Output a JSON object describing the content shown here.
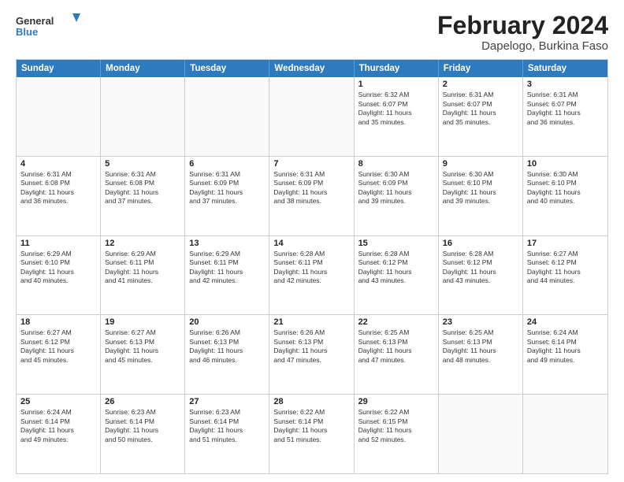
{
  "header": {
    "logo_general": "General",
    "logo_blue": "Blue",
    "title": "February 2024",
    "subtitle": "Dapelogo, Burkina Faso"
  },
  "weekdays": [
    "Sunday",
    "Monday",
    "Tuesday",
    "Wednesday",
    "Thursday",
    "Friday",
    "Saturday"
  ],
  "rows": [
    [
      {
        "day": "",
        "info": ""
      },
      {
        "day": "",
        "info": ""
      },
      {
        "day": "",
        "info": ""
      },
      {
        "day": "",
        "info": ""
      },
      {
        "day": "1",
        "info": "Sunrise: 6:32 AM\nSunset: 6:07 PM\nDaylight: 11 hours\nand 35 minutes."
      },
      {
        "day": "2",
        "info": "Sunrise: 6:31 AM\nSunset: 6:07 PM\nDaylight: 11 hours\nand 35 minutes."
      },
      {
        "day": "3",
        "info": "Sunrise: 6:31 AM\nSunset: 6:07 PM\nDaylight: 11 hours\nand 36 minutes."
      }
    ],
    [
      {
        "day": "4",
        "info": "Sunrise: 6:31 AM\nSunset: 6:08 PM\nDaylight: 11 hours\nand 36 minutes."
      },
      {
        "day": "5",
        "info": "Sunrise: 6:31 AM\nSunset: 6:08 PM\nDaylight: 11 hours\nand 37 minutes."
      },
      {
        "day": "6",
        "info": "Sunrise: 6:31 AM\nSunset: 6:09 PM\nDaylight: 11 hours\nand 37 minutes."
      },
      {
        "day": "7",
        "info": "Sunrise: 6:31 AM\nSunset: 6:09 PM\nDaylight: 11 hours\nand 38 minutes."
      },
      {
        "day": "8",
        "info": "Sunrise: 6:30 AM\nSunset: 6:09 PM\nDaylight: 11 hours\nand 39 minutes."
      },
      {
        "day": "9",
        "info": "Sunrise: 6:30 AM\nSunset: 6:10 PM\nDaylight: 11 hours\nand 39 minutes."
      },
      {
        "day": "10",
        "info": "Sunrise: 6:30 AM\nSunset: 6:10 PM\nDaylight: 11 hours\nand 40 minutes."
      }
    ],
    [
      {
        "day": "11",
        "info": "Sunrise: 6:29 AM\nSunset: 6:10 PM\nDaylight: 11 hours\nand 40 minutes."
      },
      {
        "day": "12",
        "info": "Sunrise: 6:29 AM\nSunset: 6:11 PM\nDaylight: 11 hours\nand 41 minutes."
      },
      {
        "day": "13",
        "info": "Sunrise: 6:29 AM\nSunset: 6:11 PM\nDaylight: 11 hours\nand 42 minutes."
      },
      {
        "day": "14",
        "info": "Sunrise: 6:28 AM\nSunset: 6:11 PM\nDaylight: 11 hours\nand 42 minutes."
      },
      {
        "day": "15",
        "info": "Sunrise: 6:28 AM\nSunset: 6:12 PM\nDaylight: 11 hours\nand 43 minutes."
      },
      {
        "day": "16",
        "info": "Sunrise: 6:28 AM\nSunset: 6:12 PM\nDaylight: 11 hours\nand 43 minutes."
      },
      {
        "day": "17",
        "info": "Sunrise: 6:27 AM\nSunset: 6:12 PM\nDaylight: 11 hours\nand 44 minutes."
      }
    ],
    [
      {
        "day": "18",
        "info": "Sunrise: 6:27 AM\nSunset: 6:12 PM\nDaylight: 11 hours\nand 45 minutes."
      },
      {
        "day": "19",
        "info": "Sunrise: 6:27 AM\nSunset: 6:13 PM\nDaylight: 11 hours\nand 45 minutes."
      },
      {
        "day": "20",
        "info": "Sunrise: 6:26 AM\nSunset: 6:13 PM\nDaylight: 11 hours\nand 46 minutes."
      },
      {
        "day": "21",
        "info": "Sunrise: 6:26 AM\nSunset: 6:13 PM\nDaylight: 11 hours\nand 47 minutes."
      },
      {
        "day": "22",
        "info": "Sunrise: 6:25 AM\nSunset: 6:13 PM\nDaylight: 11 hours\nand 47 minutes."
      },
      {
        "day": "23",
        "info": "Sunrise: 6:25 AM\nSunset: 6:13 PM\nDaylight: 11 hours\nand 48 minutes."
      },
      {
        "day": "24",
        "info": "Sunrise: 6:24 AM\nSunset: 6:14 PM\nDaylight: 11 hours\nand 49 minutes."
      }
    ],
    [
      {
        "day": "25",
        "info": "Sunrise: 6:24 AM\nSunset: 6:14 PM\nDaylight: 11 hours\nand 49 minutes."
      },
      {
        "day": "26",
        "info": "Sunrise: 6:23 AM\nSunset: 6:14 PM\nDaylight: 11 hours\nand 50 minutes."
      },
      {
        "day": "27",
        "info": "Sunrise: 6:23 AM\nSunset: 6:14 PM\nDaylight: 11 hours\nand 51 minutes."
      },
      {
        "day": "28",
        "info": "Sunrise: 6:22 AM\nSunset: 6:14 PM\nDaylight: 11 hours\nand 51 minutes."
      },
      {
        "day": "29",
        "info": "Sunrise: 6:22 AM\nSunset: 6:15 PM\nDaylight: 11 hours\nand 52 minutes."
      },
      {
        "day": "",
        "info": ""
      },
      {
        "day": "",
        "info": ""
      }
    ]
  ]
}
